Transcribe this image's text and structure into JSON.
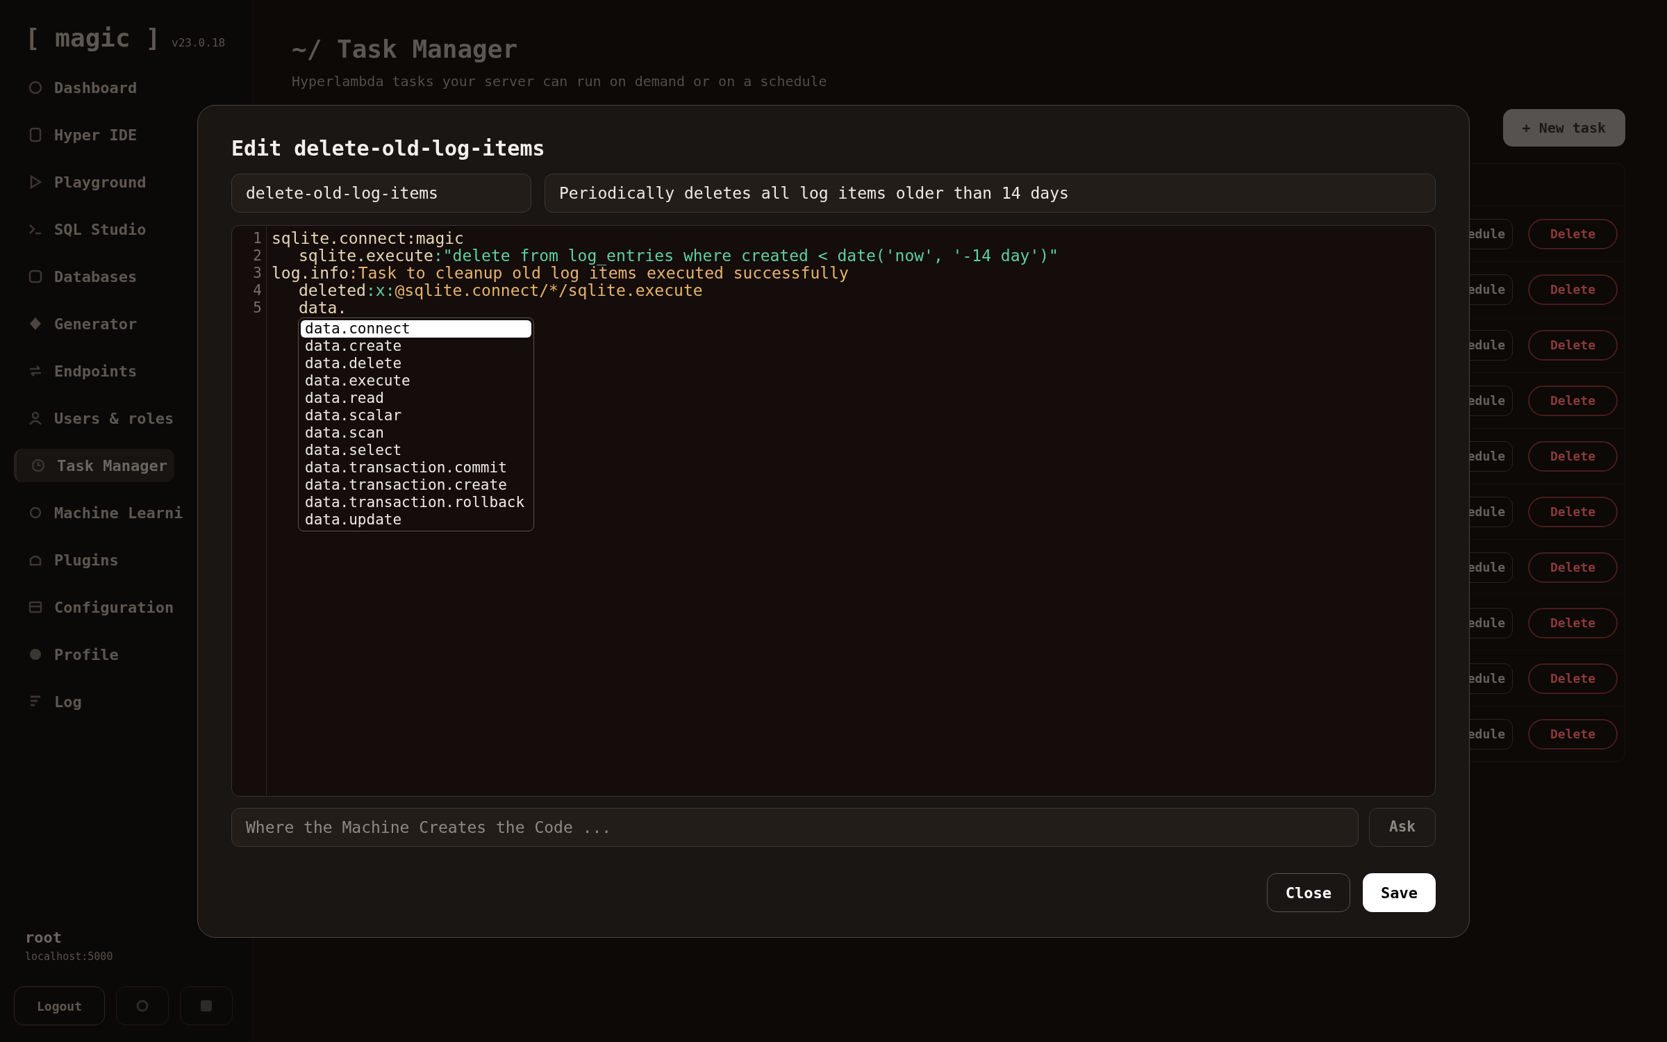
{
  "sidebar": {
    "logo": "[ magic ]",
    "version": "v23.0.18",
    "items": [
      {
        "label": "Dashboard",
        "selected": false
      },
      {
        "label": "Hyper IDE",
        "selected": false
      },
      {
        "label": "Playground",
        "selected": false
      },
      {
        "label": "SQL Studio",
        "selected": false
      },
      {
        "label": "Databases",
        "selected": false
      },
      {
        "label": "Generator",
        "selected": false
      },
      {
        "label": "Endpoints",
        "selected": false
      },
      {
        "label": "Users & roles",
        "selected": false
      },
      {
        "label": "Task Manager",
        "selected": true
      },
      {
        "label": "Machine Learni",
        "selected": false
      },
      {
        "label": "Plugins",
        "selected": false
      },
      {
        "label": "Configuration",
        "selected": false
      },
      {
        "label": "Profile",
        "selected": false
      },
      {
        "label": "Log",
        "selected": false
      }
    ],
    "user": {
      "name": "root",
      "host": "localhost:5000"
    },
    "logout_button": "Logout"
  },
  "page": {
    "title": "~/ Task Manager",
    "subtitle": "Hyperlambda tasks your server can run on demand or on a schedule",
    "new_task_button": "+ New task",
    "rows": [
      {
        "schedule": "edule",
        "delete": "Delete"
      },
      {
        "schedule": "edule",
        "delete": "Delete"
      },
      {
        "schedule": "edule",
        "delete": "Delete"
      },
      {
        "schedule": "edule",
        "delete": "Delete"
      },
      {
        "schedule": "edule",
        "delete": "Delete"
      },
      {
        "schedule": "edule",
        "delete": "Delete"
      },
      {
        "schedule": "edule",
        "delete": "Delete"
      },
      {
        "schedule": "edule",
        "delete": "Delete"
      },
      {
        "schedule": "edule",
        "delete": "Delete"
      },
      {
        "schedule": "edule",
        "delete": "Delete"
      }
    ]
  },
  "dialog": {
    "title": "Edit delete-old-log-items",
    "name_field": "delete-old-log-items",
    "description_field": "Periodically deletes all log items older than 14 days",
    "code": [
      {
        "number": "1",
        "tokens": [
          {
            "kind": "key",
            "text": "sqlite.connect"
          },
          {
            "kind": "key",
            "text": ":magic"
          }
        ],
        "children": [
          {
            "number": "2",
            "tokens": [
              {
                "kind": "key",
                "text": "sqlite.execute"
              },
              {
                "kind": "string",
                "text": ":\"delete from log_entries where created < date('now', '-14 day')\""
              }
            ]
          }
        ]
      },
      {
        "number": "3",
        "tokens": [
          {
            "kind": "key",
            "text": "log.info"
          },
          {
            "kind": "value",
            "text": ":Task to cleanup old log items executed successfully"
          }
        ],
        "children": [
          {
            "number": "4",
            "tokens": [
              {
                "kind": "key",
                "text": "deleted"
              },
              {
                "kind": "string",
                "text": ":x:"
              },
              {
                "kind": "value",
                "text": "@sqlite.connect/*/sqlite.execute"
              }
            ]
          },
          {
            "number": "5",
            "tokens": [
              {
                "kind": "key",
                "text": "data."
              }
            ]
          }
        ]
      }
    ],
    "autocomplete": [
      {
        "label": "data.connect",
        "selected": true
      },
      {
        "label": "data.create",
        "selected": false
      },
      {
        "label": "data.delete",
        "selected": false
      },
      {
        "label": "data.execute",
        "selected": false
      },
      {
        "label": "data.read",
        "selected": false
      },
      {
        "label": "data.scalar",
        "selected": false
      },
      {
        "label": "data.scan",
        "selected": false
      },
      {
        "label": "data.select",
        "selected": false
      },
      {
        "label": "data.transaction.commit",
        "selected": false
      },
      {
        "label": "data.transaction.create",
        "selected": false
      },
      {
        "label": "data.transaction.rollback",
        "selected": false
      },
      {
        "label": "data.update",
        "selected": false
      }
    ],
    "ask_field": {
      "placeholder": "Where the Machine Creates the Code ..."
    },
    "ask_button": "Ask",
    "buttons": [
      {
        "label": "Close",
        "kind": "secondary"
      },
      {
        "label": "Save",
        "kind": "primary"
      }
    ]
  }
}
